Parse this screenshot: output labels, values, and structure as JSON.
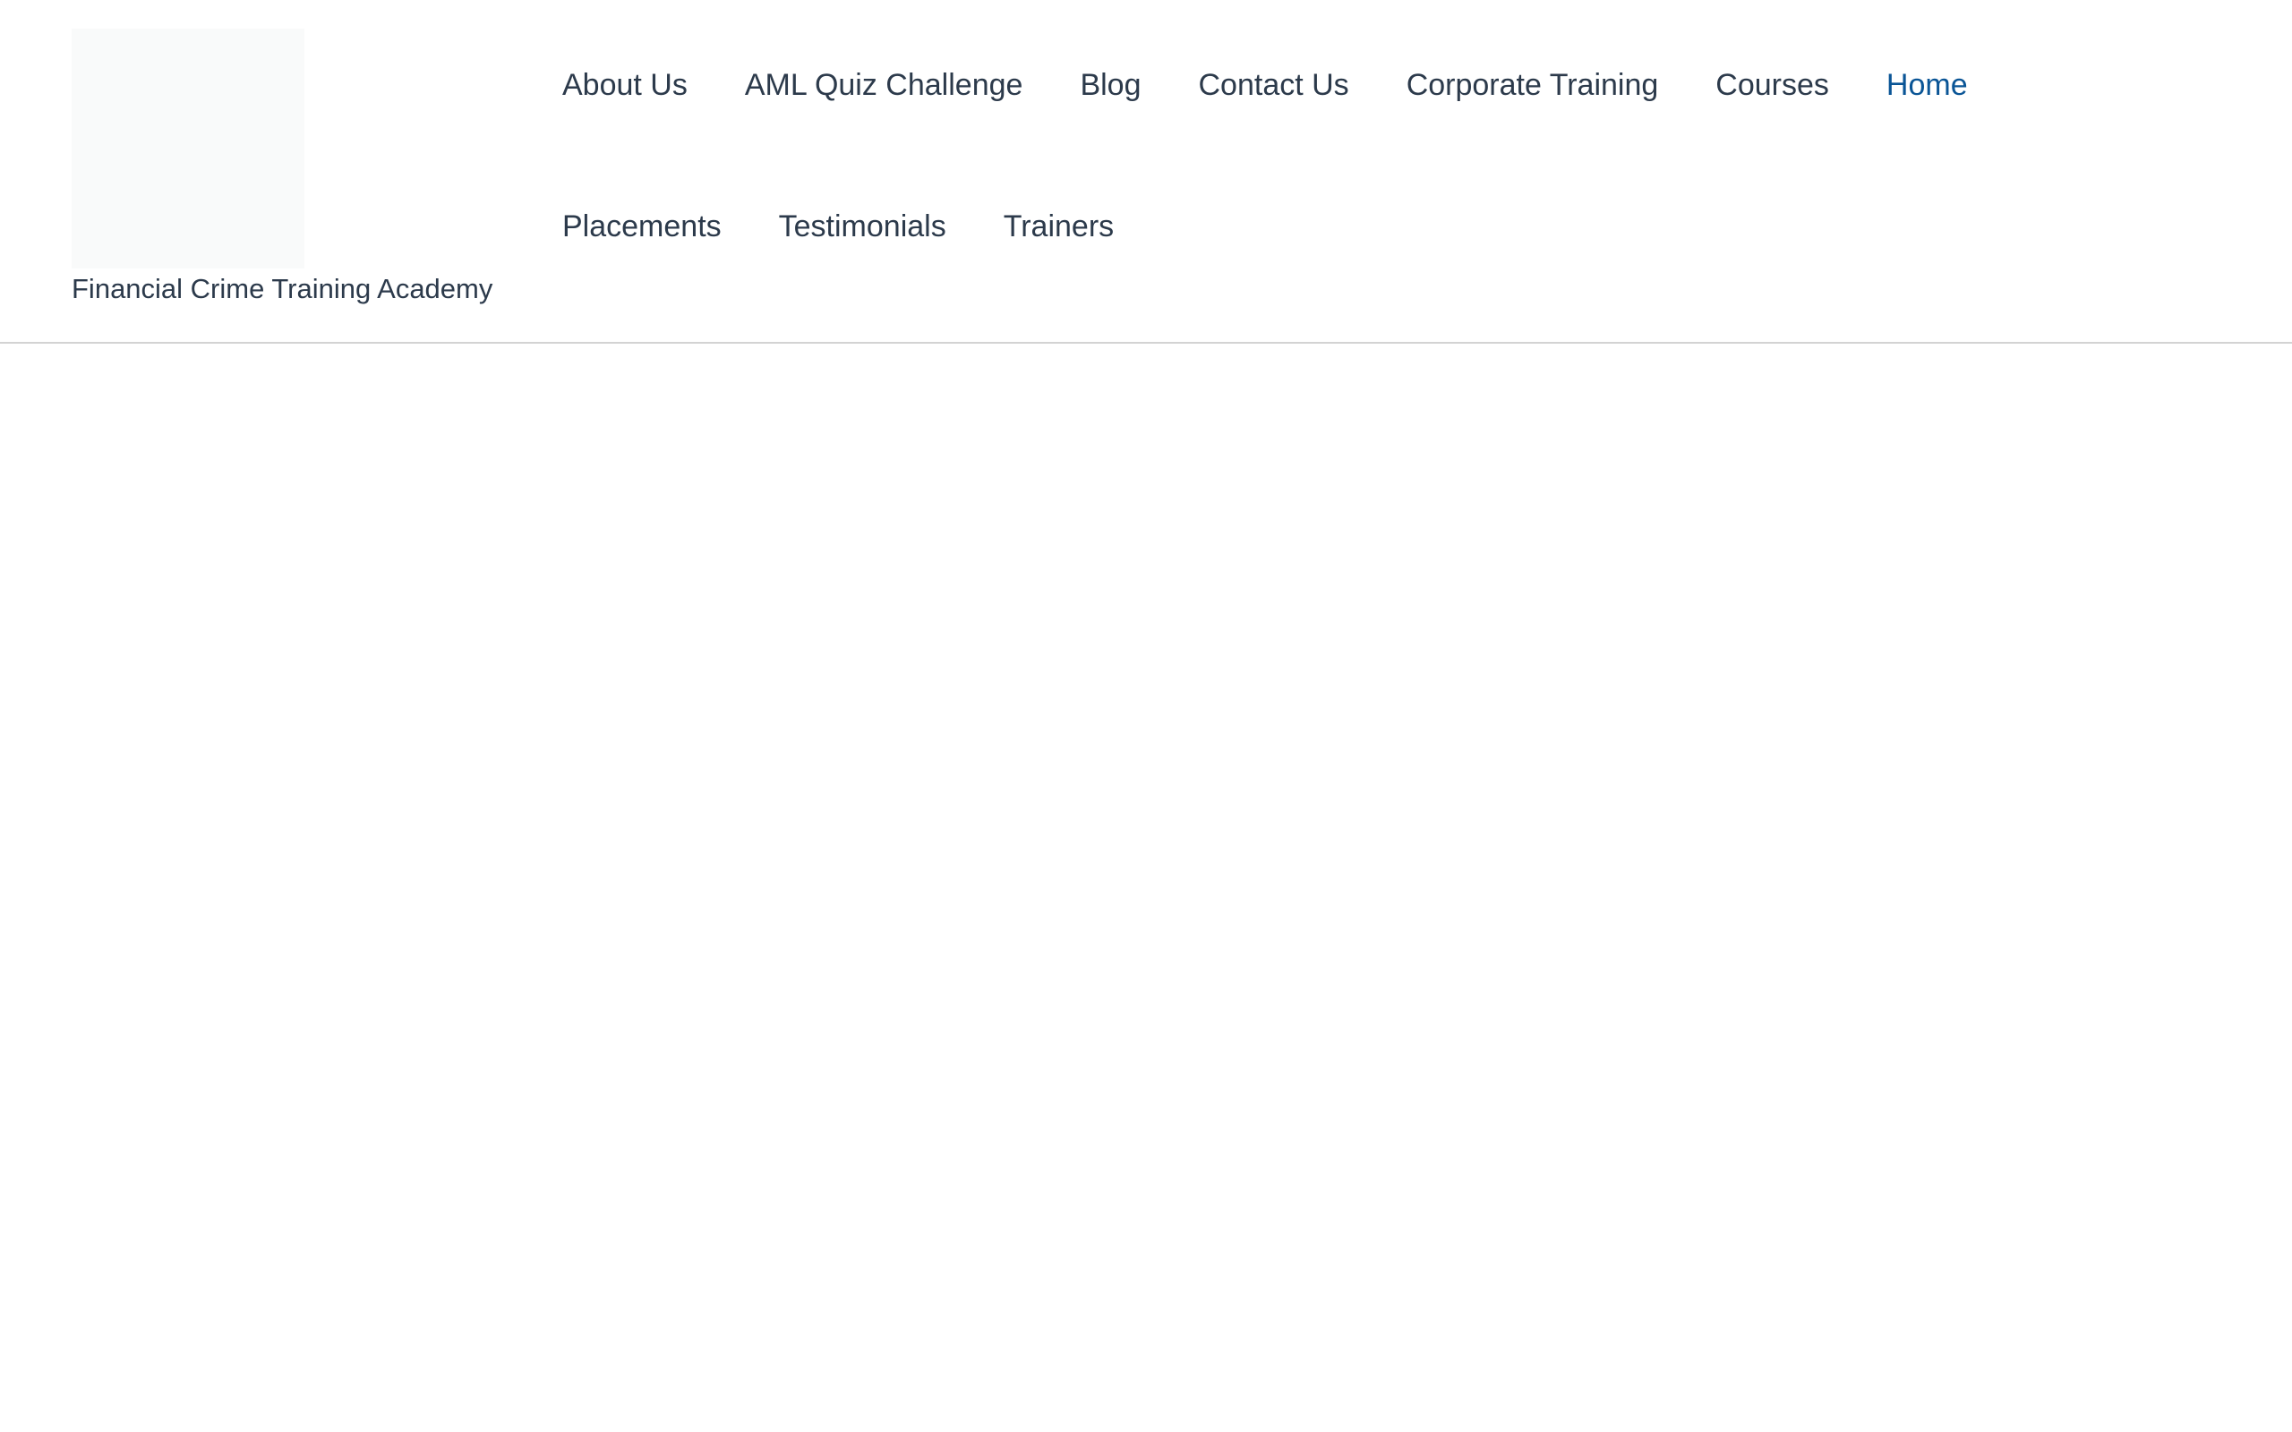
{
  "header": {
    "site_title": "Financial Crime Training Academy",
    "logo_alt": "Logo"
  },
  "nav": {
    "items": [
      {
        "label": "About Us",
        "active": false
      },
      {
        "label": "AML Quiz Challenge",
        "active": false
      },
      {
        "label": "Blog",
        "active": false
      },
      {
        "label": "Contact Us",
        "active": false
      },
      {
        "label": "Corporate Training",
        "active": false
      },
      {
        "label": "Courses",
        "active": false
      },
      {
        "label": "Home",
        "active": true
      },
      {
        "label": "Placements",
        "active": false
      },
      {
        "label": "Testimonials",
        "active": false
      },
      {
        "label": "Trainers",
        "active": false
      }
    ]
  },
  "colors": {
    "text": "#2c3a4b",
    "active": "#0a5596",
    "divider": "#d3d3d3",
    "logo_placeholder": "#f9fafa"
  }
}
